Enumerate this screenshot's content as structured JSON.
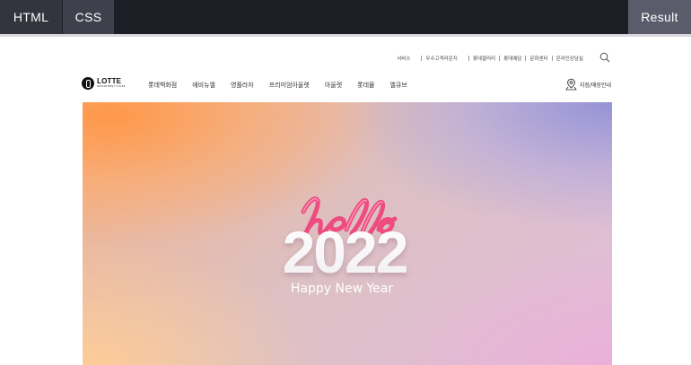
{
  "editor": {
    "tabs": {
      "html": "HTML",
      "css": "CSS",
      "result": "Result"
    }
  },
  "site": {
    "utility_links": [
      "서비스",
      "우수고객라운지",
      "롯데갤러리",
      "롯데예담",
      "문화센터",
      "온라인상담실"
    ],
    "logo": {
      "brand": "LOTTE",
      "sub": "DEPARTMENT STORE"
    },
    "nav": [
      "롯데백화점",
      "에비뉴엘",
      "영플라자",
      "프리미엄아울렛",
      "아울렛",
      "롯데몰",
      "엘큐브"
    ],
    "store_link": "지점/매장안내",
    "icons": {
      "search": "search-icon",
      "store": "location-pin-icon"
    }
  },
  "banner": {
    "script": "hello",
    "year": "2022",
    "caption": "Happy New Year",
    "colors": {
      "script": "#ef4f82",
      "year": "#ffffff",
      "top_left": "#ff9a4e",
      "top_right": "#9b9bdb",
      "bottom_right": "#e9b5d8"
    }
  }
}
